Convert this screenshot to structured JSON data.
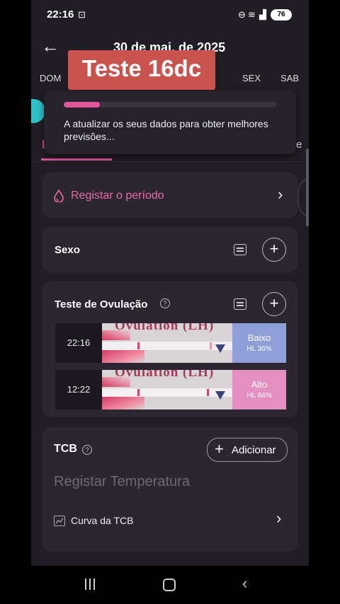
{
  "status_bar": {
    "time": "22:16",
    "battery": "76"
  },
  "header": {
    "date": "30 de mai. de 2025"
  },
  "weekdays": [
    "DOM",
    "SEX",
    "SAB"
  ],
  "overlay_title": "Teste 16dc",
  "toast": {
    "text": "A atualizar os seus dados para obter melhores previsões...",
    "progress": 0.17
  },
  "period": {
    "label": "Registar o período"
  },
  "sexo": {
    "title": "Sexo"
  },
  "ovulation": {
    "title": "Teste de Ovulação",
    "strip_text": "Ovulation (LH)",
    "tests": [
      {
        "time": "22:16",
        "result": "Baixo",
        "hl": "HL 36%",
        "color": "#8e9fd8"
      },
      {
        "time": "12:22",
        "result": "Alto",
        "hl": "HL 84%",
        "color": "#e48fc0"
      }
    ]
  },
  "tcb": {
    "title": "TCB",
    "add_label": "Adicionar",
    "placeholder": "Registar Temperatura",
    "curve_label": "Curva da TCB"
  },
  "colors": {
    "accent": "#e0559a",
    "background": "#211d24",
    "card": "#2b2630"
  }
}
